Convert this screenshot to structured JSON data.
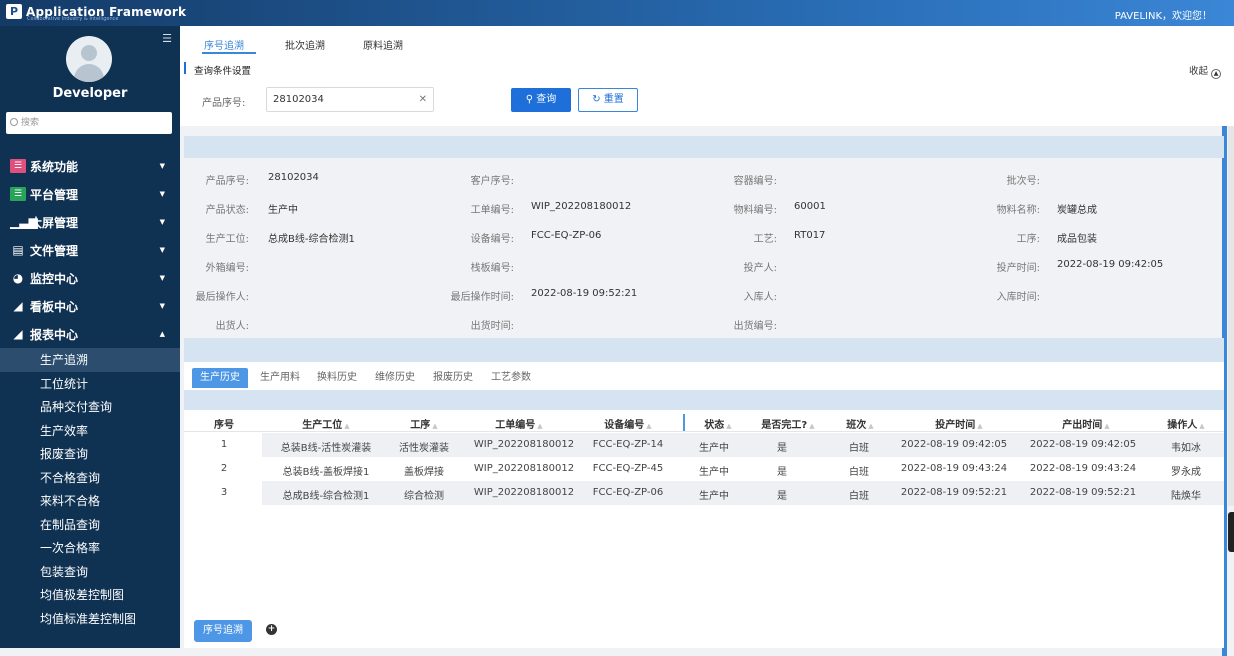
{
  "app": {
    "logo_mark": "P",
    "logo_text": "Application Framework",
    "logo_sub": "Collaborative Industry & Intelligence",
    "welcome": "PAVELINK，欢迎您！"
  },
  "sidebar": {
    "username": "Developer",
    "search_placeholder": "搜索",
    "menus": [
      {
        "label": "系统功能",
        "icon": "list-icon"
      },
      {
        "label": "平台管理",
        "icon": "list-icon"
      },
      {
        "label": "大屏管理",
        "icon": "bar-chart-icon"
      },
      {
        "label": "文件管理",
        "icon": "file-icon"
      },
      {
        "label": "监控中心",
        "icon": "gauge-icon"
      },
      {
        "label": "看板中心",
        "icon": "line-chart-icon"
      },
      {
        "label": "报表中心",
        "icon": "line-chart-icon"
      }
    ],
    "submenu": [
      "生产追溯",
      "工位统计",
      "品种交付查询",
      "生产效率",
      "报废查询",
      "不合格查询",
      "来料不合格",
      "在制品查询",
      "一次合格率",
      "包装查询",
      "均值极差控制图",
      "均值标准差控制图"
    ]
  },
  "tabs": [
    "序号追溯",
    "批次追溯",
    "原料追溯"
  ],
  "query": {
    "section_title": "查询条件设置",
    "collapse": "收起",
    "label": "产品序号:",
    "value": "28102034",
    "search_btn": "查询",
    "reset_btn": "重置"
  },
  "info": [
    {
      "label": "产品序号:",
      "value": "28102034"
    },
    {
      "label": "客户序号:",
      "value": ""
    },
    {
      "label": "容器编号:",
      "value": ""
    },
    {
      "label": "批次号:",
      "value": ""
    },
    {
      "label": "产品状态:",
      "value": "生产中"
    },
    {
      "label": "工单编号:",
      "value": "WIP_202208180012"
    },
    {
      "label": "物料编号:",
      "value": "60001"
    },
    {
      "label": "物料名称:",
      "value": "炭罐总成"
    },
    {
      "label": "生产工位:",
      "value": "总成B线-综合检测1"
    },
    {
      "label": "设备编号:",
      "value": "FCC-EQ-ZP-06"
    },
    {
      "label": "工艺:",
      "value": "RT017"
    },
    {
      "label": "工序:",
      "value": "成品包装"
    },
    {
      "label": "外箱编号:",
      "value": ""
    },
    {
      "label": "栈板编号:",
      "value": ""
    },
    {
      "label": "投产人:",
      "value": ""
    },
    {
      "label": "投产时间:",
      "value": "2022-08-19 09:42:05"
    },
    {
      "label": "最后操作人:",
      "value": ""
    },
    {
      "label": "最后操作时间:",
      "value": "2022-08-19 09:52:21"
    },
    {
      "label": "入库人:",
      "value": ""
    },
    {
      "label": "入库时间:",
      "value": ""
    },
    {
      "label": "出货人:",
      "value": ""
    },
    {
      "label": "出货时间:",
      "value": ""
    },
    {
      "label": "出货编号:",
      "value": ""
    }
  ],
  "detail_tabs": [
    "生产历史",
    "生产用料",
    "换料历史",
    "维修历史",
    "报废历史",
    "工艺参数"
  ],
  "table": {
    "headers": [
      "序号",
      "生产工位",
      "工序",
      "工单编号",
      "设备编号",
      "状态",
      "是否完工?",
      "班次",
      "投产时间",
      "产出时间",
      "操作人"
    ],
    "rows": [
      [
        "1",
        "总装B线-活性炭灌装",
        "活性炭灌装",
        "WIP_202208180012",
        "FCC-EQ-ZP-14",
        "生产中",
        "是",
        "白班",
        "2022-08-19 09:42:05",
        "2022-08-19 09:42:05",
        "韦如冰"
      ],
      [
        "2",
        "总装B线-盖板焊接1",
        "盖板焊接",
        "WIP_202208180012",
        "FCC-EQ-ZP-45",
        "生产中",
        "是",
        "白班",
        "2022-08-19 09:43:24",
        "2022-08-19 09:43:24",
        "罗永成"
      ],
      [
        "3",
        "总成B线-综合检测1",
        "综合检测",
        "WIP_202208180012",
        "FCC-EQ-ZP-06",
        "生产中",
        "是",
        "白班",
        "2022-08-19 09:52:21",
        "2022-08-19 09:52:21",
        "陆焕华"
      ]
    ]
  },
  "bottom_tab": "序号追溯",
  "colors": {
    "primary": "#1e6fd9",
    "sidebar": "#0f3152",
    "band": "#d6e4f1"
  }
}
